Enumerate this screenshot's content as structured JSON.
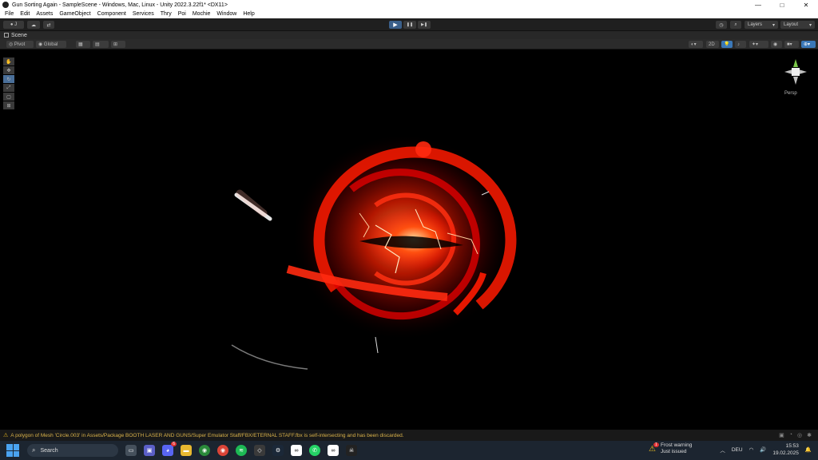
{
  "window": {
    "title": "Gun Sorting Again - SampleScene - Windows, Mac, Linux - Unity 2022.3.22f1* <DX11>",
    "minimize": "—",
    "maximize": "□",
    "close": "✕"
  },
  "menu": [
    "File",
    "Edit",
    "Assets",
    "GameObject",
    "Component",
    "Services",
    "Thry",
    "Poi",
    "Mochie",
    "Window",
    "Help"
  ],
  "toolbar": {
    "account_label": "J",
    "layers_label": "Layers",
    "layout_label": "Layout",
    "play_icon": "▶",
    "pause_icon": "❚❚",
    "step_icon": "▶❚"
  },
  "scene_tab": {
    "label": "Scene"
  },
  "scene_bar": {
    "pivot_label": "Pivot",
    "global_label": "Global",
    "mode_2d": "2D"
  },
  "view": {
    "projection_label": "Persp"
  },
  "status": {
    "message": "A polygon of Mesh 'Circle.003' in Assets/Package BOOTH LASER AND GUNS/Super Emulator Staff/FBX/ETERNAL STAFF.fbx is self-intersecting and has been discarded."
  },
  "taskbar": {
    "search_placeholder": "Search",
    "notification_title": "Frost warning",
    "notification_sub": "Just issued",
    "notification_badge": "1",
    "language": "DEU",
    "time": "15:53",
    "date": "19.02.2025",
    "discord_badge": "6"
  }
}
